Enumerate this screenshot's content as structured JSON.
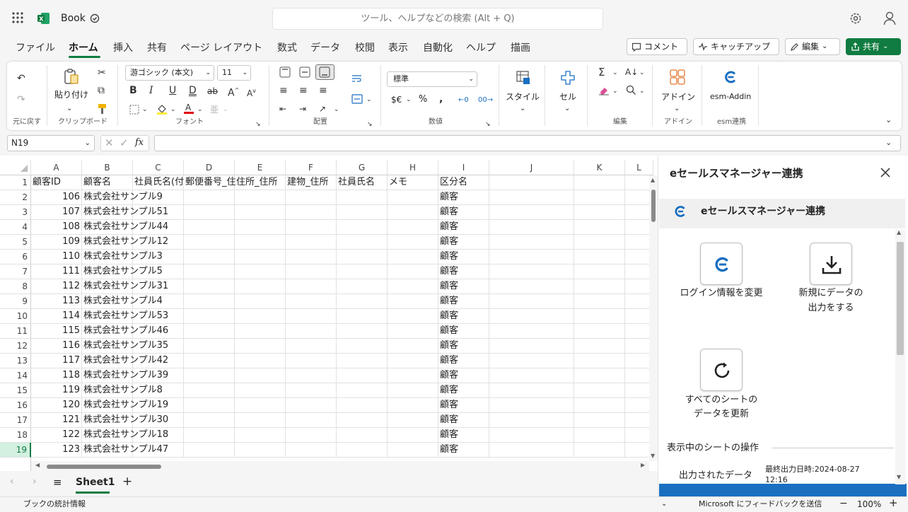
{
  "titlebar": {
    "app_name": "Book",
    "search_placeholder": "ツール、ヘルプなどの検索 (Alt + Q)"
  },
  "menu": {
    "tabs": [
      "ファイル",
      "ホーム",
      "挿入",
      "共有",
      "ページ レイアウト",
      "数式",
      "データ",
      "校閲",
      "表示",
      "自動化",
      "ヘルプ",
      "描画"
    ],
    "active_tab": "ホーム",
    "comment_label": "コメント",
    "catchup_label": "キャッチアップ",
    "edit_label": "編集",
    "share_label": "共有"
  },
  "ribbon": {
    "undo_group": "元に戻す",
    "paste_label": "貼り付け",
    "clipboard_group": "クリップボード",
    "font_name": "游ゴシック (本文)",
    "font_size": "11",
    "font_group": "フォント",
    "alignment_group": "配置",
    "number_format": "標準",
    "currency_label": "$€",
    "percent_label": "%",
    "number_group": "数値",
    "styles_label": "スタイル",
    "cells_label": "セル",
    "editing_group": "編集",
    "addins_label": "アドイン",
    "addins_group": "アドイン",
    "esm_label": "esm-Addin",
    "esm_group": "esm連携"
  },
  "formula_bar": {
    "name_box": "N19",
    "formula": ""
  },
  "grid": {
    "columns": [
      "A",
      "B",
      "C",
      "D",
      "E",
      "F",
      "G",
      "H",
      "I",
      "J",
      "K",
      "L"
    ],
    "header_row": [
      "顧客ID",
      "顧客名",
      "社員氏名(付",
      "郵便番号_住",
      "住所_住所",
      "建物_住所",
      "社員氏名",
      "メモ",
      "区分名"
    ],
    "rows": [
      {
        "row": "2",
        "id": "106",
        "name": "株式会社サンプル9",
        "kubun": "顧客"
      },
      {
        "row": "3",
        "id": "107",
        "name": "株式会社サンプル51",
        "kubun": "顧客"
      },
      {
        "row": "4",
        "id": "108",
        "name": "株式会社サンプル44",
        "kubun": "顧客"
      },
      {
        "row": "5",
        "id": "109",
        "name": "株式会社サンプル12",
        "kubun": "顧客"
      },
      {
        "row": "6",
        "id": "110",
        "name": "株式会社サンプル3",
        "kubun": "顧客"
      },
      {
        "row": "7",
        "id": "111",
        "name": "株式会社サンプル5",
        "kubun": "顧客"
      },
      {
        "row": "8",
        "id": "112",
        "name": "株式会社サンプル31",
        "kubun": "顧客"
      },
      {
        "row": "9",
        "id": "113",
        "name": "株式会社サンプル4",
        "kubun": "顧客"
      },
      {
        "row": "10",
        "id": "114",
        "name": "株式会社サンプル53",
        "kubun": "顧客"
      },
      {
        "row": "11",
        "id": "115",
        "name": "株式会社サンプル46",
        "kubun": "顧客"
      },
      {
        "row": "12",
        "id": "116",
        "name": "株式会社サンプル35",
        "kubun": "顧客"
      },
      {
        "row": "13",
        "id": "117",
        "name": "株式会社サンプル42",
        "kubun": "顧客"
      },
      {
        "row": "14",
        "id": "118",
        "name": "株式会社サンプル39",
        "kubun": "顧客"
      },
      {
        "row": "15",
        "id": "119",
        "name": "株式会社サンプル8",
        "kubun": "顧客"
      },
      {
        "row": "16",
        "id": "120",
        "name": "株式会社サンプル19",
        "kubun": "顧客"
      },
      {
        "row": "17",
        "id": "121",
        "name": "株式会社サンプル30",
        "kubun": "顧客"
      },
      {
        "row": "18",
        "id": "122",
        "name": "株式会社サンプル18",
        "kubun": "顧客"
      },
      {
        "row": "19",
        "id": "123",
        "name": "株式会社サンプル47",
        "kubun": "顧客"
      }
    ],
    "selected_row": "19"
  },
  "sheets": {
    "active": "Sheet1"
  },
  "status": {
    "left": "ブックの統計情報",
    "feedback": "Microsoft にフィードバックを送信",
    "zoom": "100%"
  },
  "pane": {
    "title": "eセールスマネージャー連携",
    "header_title": "eセールスマネージャー連携",
    "tile_login": "ログイン情報を変更",
    "tile_output_1": "新規にデータの",
    "tile_output_2": "出力をする",
    "tile_refresh_1": "すべてのシートの",
    "tile_refresh_2": "データを更新",
    "section_title": "表示中のシートの操作",
    "output_data_label": "出力されたデータ",
    "last_output": "最終出力日時:2024-08-27",
    "last_output_time": "12:16"
  },
  "colors": {
    "accent": "#107c41",
    "esm_blue": "#1a6fc1"
  }
}
